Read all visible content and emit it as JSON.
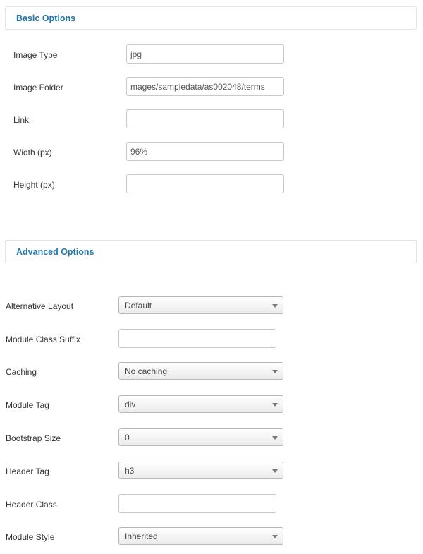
{
  "basic": {
    "title": "Basic Options",
    "fields": {
      "image_type": {
        "label": "Image Type",
        "value": "jpg"
      },
      "image_folder": {
        "label": "Image Folder",
        "value": "mages/sampledata/as002048/terms"
      },
      "link": {
        "label": "Link",
        "value": ""
      },
      "width": {
        "label": "Width (px)",
        "value": "96%"
      },
      "height": {
        "label": "Height (px)",
        "value": ""
      }
    }
  },
  "advanced": {
    "title": "Advanced Options",
    "fields": {
      "alt_layout": {
        "label": "Alternative Layout",
        "value": "Default"
      },
      "module_class_suffix": {
        "label": "Module Class Suffix",
        "value": ""
      },
      "caching": {
        "label": "Caching",
        "value": "No caching"
      },
      "module_tag": {
        "label": "Module Tag",
        "value": "div"
      },
      "bootstrap_size": {
        "label": "Bootstrap Size",
        "value": "0"
      },
      "header_tag": {
        "label": "Header Tag",
        "value": "h3"
      },
      "header_class": {
        "label": "Header Class",
        "value": ""
      },
      "module_style": {
        "label": "Module Style",
        "value": "Inherited"
      }
    }
  }
}
